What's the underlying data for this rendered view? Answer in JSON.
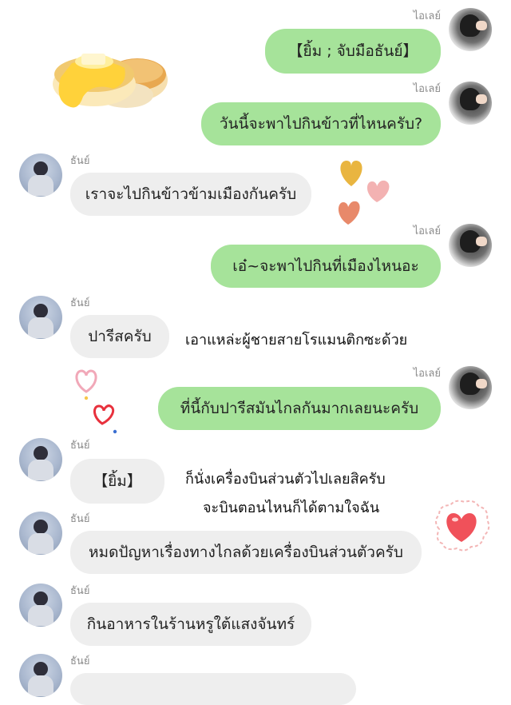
{
  "participants": {
    "left_name": "ธันย์",
    "right_name": "ไอเลย์"
  },
  "messages": [
    {
      "side": "right",
      "sender": "ไอเลย์",
      "text": "【ยิ้ม ; จับมือธันย์】"
    },
    {
      "side": "right",
      "sender": "ไอเลย์",
      "text": "วันนี้จะพาไปกินข้าวที่ไหนครับ?"
    },
    {
      "side": "left",
      "sender": "ธันย์",
      "text": "เราจะไปกินข้าวข้ามเมืองกันครับ"
    },
    {
      "side": "right",
      "sender": "ไอเลย์",
      "text": "เอ๋~จะพาไปกินที่เมืองไหนอะ"
    },
    {
      "side": "left",
      "sender": "ธันย์",
      "text": "ปารีสครับ"
    },
    {
      "side": "right",
      "sender": "ไอเลย์",
      "text": "ที่นี้กับปารีสมันไกลกันมากเลยนะครับ"
    },
    {
      "side": "left",
      "sender": "ธันย์",
      "text": "【ยิ้ม】"
    },
    {
      "side": "left",
      "sender": "ธันย์",
      "text": "หมดปัญหาเรื่องทางไกลด้วยเครื่องบินส่วนตัวครับ"
    },
    {
      "side": "left",
      "sender": "ธันย์",
      "text": "กินอาหารในร้านหรูใต้แสงจันทร์"
    },
    {
      "side": "left",
      "sender": "ธันย์",
      "text": ""
    }
  ],
  "annotations": {
    "romantic_note": "เอาแหล่ะผู้ชายสายโรแมนติกซะด้วย",
    "jet_line1": "ก็นั่งเครื่องบินส่วนตัวไปเลยสิครับ",
    "jet_line2": "จะบินตอนไหนก็ได้ตามใจฉัน"
  },
  "colors": {
    "sent_bubble": "#a6e39a",
    "received_bubble": "#eeeeee",
    "name_text": "#8a8a8a"
  },
  "decorations": [
    "pancake-sticker",
    "hearts-sticker",
    "heart-outline-sticker",
    "heart-cloud-sticker"
  ]
}
